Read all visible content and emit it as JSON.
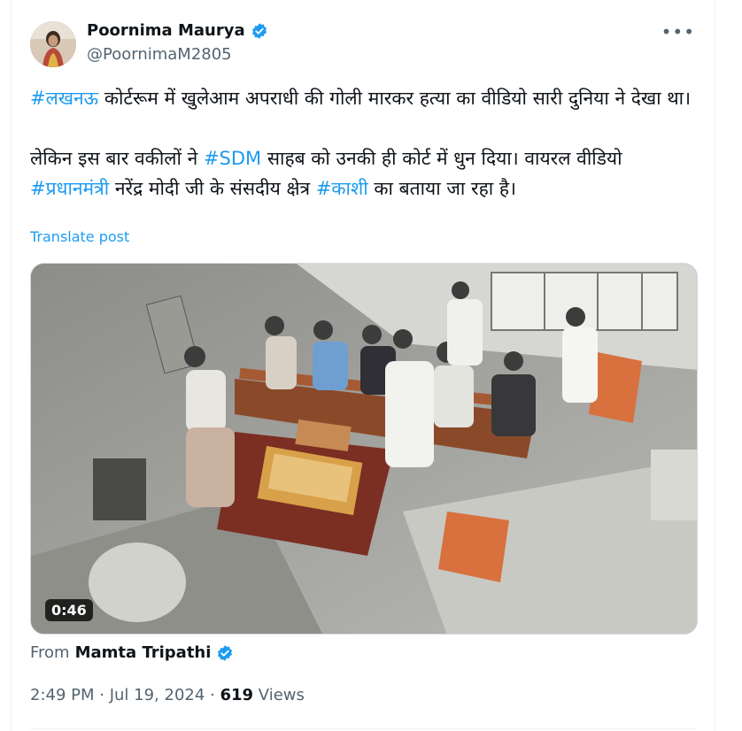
{
  "author": {
    "name": "Poornima Maurya",
    "handle": "@PoornimaM2805"
  },
  "menu_icon": "more-horizontal-icon",
  "tweet": {
    "line1": [
      {
        "text": "#लखनऊ",
        "tag": true
      },
      {
        "text": " कोर्टरूम में खुलेआम अपराधी की गोली मारकर हत्या का वीडियो सारी दुनिया ने देखा था।",
        "tag": false
      }
    ],
    "line2": [
      {
        "text": "लेकिन इस बार वकीलों  ने ",
        "tag": false
      },
      {
        "text": "#SDM",
        "tag": true
      },
      {
        "text": " साहब को उनकी ही कोर्ट में धुन दिया। वायरल वीडियो ",
        "tag": false
      },
      {
        "text": "#प्रधानमंत्री",
        "tag": true
      },
      {
        "text": " नरेंद्र मोदी जी के संसदीय क्षेत्र ",
        "tag": false
      },
      {
        "text": "#काशी",
        "tag": true
      },
      {
        "text": " का बताया जा रहा है।",
        "tag": false
      }
    ]
  },
  "translate_label": "Translate post",
  "video": {
    "duration": "0:46"
  },
  "from": {
    "prefix": "From",
    "name": "Mamta Tripathi"
  },
  "meta": {
    "time": "2:49 PM",
    "sep1": " · ",
    "date": "Jul 19, 2024",
    "sep2": " · ",
    "views_count": "619",
    "views_label": " Views"
  },
  "colors": {
    "link": "#1d9bf0",
    "secondary": "#536471",
    "verified": "#1d9bf0"
  }
}
